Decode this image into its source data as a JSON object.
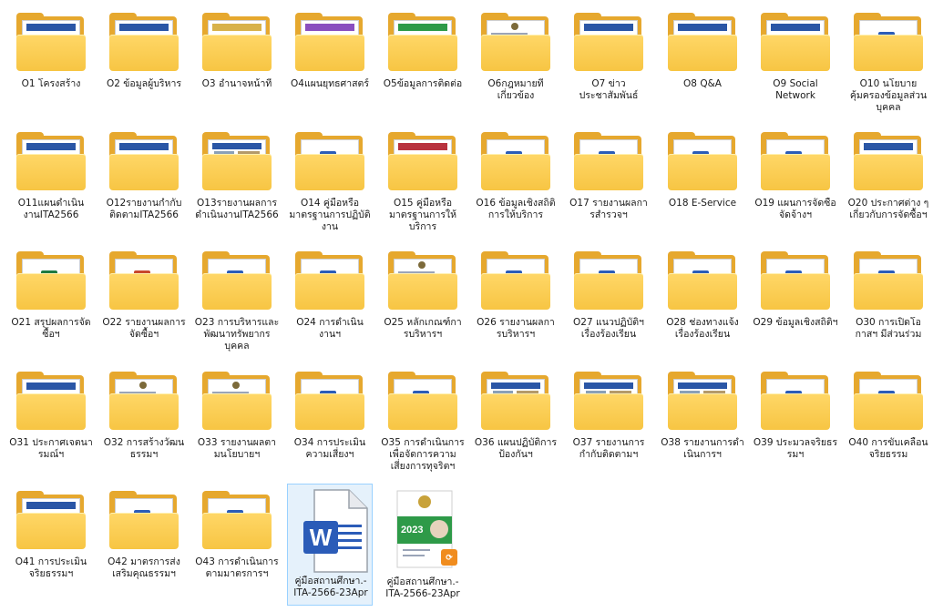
{
  "colors": {
    "folder_front": "#f7c543",
    "folder_back": "#e6a82e",
    "selection_bg": "#e5f1fb",
    "selection_border": "#99d1ff",
    "word_blue": "#2b5cb8",
    "pdf_orange": "#f08c1e"
  },
  "items": [
    {
      "label": "O1 โครงสร้าง",
      "kind": "folder",
      "preview": "doc-banner-blue",
      "icon": "folder-icon"
    },
    {
      "label": "O2 ข้อมูลผู้บริหาร",
      "kind": "folder",
      "preview": "doc-banner-blue",
      "icon": "folder-icon"
    },
    {
      "label": "O3 อำนาจหน้าที่",
      "kind": "folder",
      "preview": "doc-banner-gold",
      "icon": "folder-icon"
    },
    {
      "label": "O4แผนยุทธศาสตร์",
      "kind": "folder",
      "preview": "doc-banner-purple",
      "icon": "folder-icon"
    },
    {
      "label": "O5ข้อมูลการติดต่อ",
      "kind": "folder",
      "preview": "doc-banner-green",
      "icon": "folder-icon"
    },
    {
      "label": "O6กฎหมายที่เกี่ยวข้อง",
      "kind": "folder",
      "preview": "doc-text",
      "icon": "folder-icon"
    },
    {
      "label": "O7 ข่าวประชาสัมพันธ์",
      "kind": "folder",
      "preview": "doc-banner-blue",
      "icon": "folder-icon"
    },
    {
      "label": "O8 Q&A",
      "kind": "folder",
      "preview": "doc-banner-blue",
      "icon": "folder-icon"
    },
    {
      "label": "O9 Social Network",
      "kind": "folder",
      "preview": "doc-banner-blue",
      "icon": "folder-icon"
    },
    {
      "label": "O10 นโยบายคุ้มครองข้อมูลส่วนบุคคล",
      "kind": "folder",
      "preview": "word",
      "icon": "folder-icon"
    },
    {
      "label": "O11แผนดำเนินงานITA2566",
      "kind": "folder",
      "preview": "doc-banner-blue",
      "icon": "folder-icon"
    },
    {
      "label": "O12รายงานกำกับติดตามITA2566",
      "kind": "folder",
      "preview": "doc-banner-blue",
      "icon": "folder-icon"
    },
    {
      "label": "O13รายงานผลการดำเนินงานITA2566",
      "kind": "folder",
      "preview": "doc-photo",
      "icon": "folder-icon"
    },
    {
      "label": "O14 คู่มือหรือมาตรฐานการปฏิบัติงาน",
      "kind": "folder",
      "preview": "word",
      "icon": "folder-icon"
    },
    {
      "label": "O15 คู่มือหรือมาตรฐานการให้บริการ",
      "kind": "folder",
      "preview": "doc-banner-red",
      "icon": "folder-icon"
    },
    {
      "label": "O16 ข้อมูลเชิงสถิติการให้บริการ",
      "kind": "folder",
      "preview": "word",
      "icon": "folder-icon"
    },
    {
      "label": "O17 รายงานผลการสำรวจฯ",
      "kind": "folder",
      "preview": "word",
      "icon": "folder-icon"
    },
    {
      "label": "O18 E-Service",
      "kind": "folder",
      "preview": "word",
      "icon": "folder-icon"
    },
    {
      "label": "O19 แผนการจัดซื้อจัดจ้างฯ",
      "kind": "folder",
      "preview": "word",
      "icon": "folder-icon"
    },
    {
      "label": "O20 ประกาศต่าง ๆ เกี่ยวกับการจัดซื้อฯ",
      "kind": "folder",
      "preview": "doc-banner-blue",
      "icon": "folder-icon"
    },
    {
      "label": "O21 สรุปผลการจัดซื้อฯ",
      "kind": "folder",
      "preview": "excel",
      "icon": "folder-icon"
    },
    {
      "label": "O22 รายงานผลการจัดซื้อฯ",
      "kind": "folder",
      "preview": "powerpoint",
      "icon": "folder-icon"
    },
    {
      "label": "O23 การบริหารและพัฒนาทรัพยากรบุคคล",
      "kind": "folder",
      "preview": "word",
      "icon": "folder-icon"
    },
    {
      "label": "O24 การดำเนินงานฯ",
      "kind": "folder",
      "preview": "word",
      "icon": "folder-icon"
    },
    {
      "label": "O25 หลักเกณฑ์การบริหารฯ",
      "kind": "folder",
      "preview": "doc-text",
      "icon": "folder-icon"
    },
    {
      "label": "O26 รายงานผลการบริหารฯ",
      "kind": "folder",
      "preview": "word",
      "icon": "folder-icon"
    },
    {
      "label": "O27 แนวปฏิบัติฯ เรื่องร้องเรียน",
      "kind": "folder",
      "preview": "word",
      "icon": "folder-icon"
    },
    {
      "label": "O28 ช่องทางแจ้งเรื่องร้องเรียน",
      "kind": "folder",
      "preview": "word",
      "icon": "folder-icon"
    },
    {
      "label": "O29 ข้อมูลเชิงสถิติฯ",
      "kind": "folder",
      "preview": "word",
      "icon": "folder-icon"
    },
    {
      "label": "O30 การเปิดโอกาสฯ มีส่วนร่วม",
      "kind": "folder",
      "preview": "word",
      "icon": "folder-icon"
    },
    {
      "label": "O31 ประกาศเจตนารมณ์ฯ",
      "kind": "folder",
      "preview": "doc-banner-blue",
      "icon": "folder-icon"
    },
    {
      "label": "O32 การสร้างวัฒนธรรมฯ",
      "kind": "folder",
      "preview": "doc-text",
      "icon": "folder-icon"
    },
    {
      "label": "O33 รายงานผลตามนโยบายฯ",
      "kind": "folder",
      "preview": "doc-text",
      "icon": "folder-icon"
    },
    {
      "label": "O34 การประเมินความเสี่ยงฯ",
      "kind": "folder",
      "preview": "word",
      "icon": "folder-icon"
    },
    {
      "label": "O35 การดำเนินการเพื่อจัดการความเสี่ยงการทุจริตฯ",
      "kind": "folder",
      "preview": "word",
      "icon": "folder-icon"
    },
    {
      "label": "O36 แผนปฏิบัติการป้องกันฯ",
      "kind": "folder",
      "preview": "doc-photo",
      "icon": "folder-icon"
    },
    {
      "label": "O37  รายงานการกำกับติดตามฯ",
      "kind": "folder",
      "preview": "doc-photo",
      "icon": "folder-icon"
    },
    {
      "label": "O38 รายงานการดำเนินการฯ",
      "kind": "folder",
      "preview": "doc-photo",
      "icon": "folder-icon"
    },
    {
      "label": "O39 ประมวลจริยธรรมฯ",
      "kind": "folder",
      "preview": "word",
      "icon": "folder-icon"
    },
    {
      "label": "O40 การขับเคลื่อนจริยธรรม",
      "kind": "folder",
      "preview": "word",
      "icon": "folder-icon"
    },
    {
      "label": "O41 การประเมินจริยธรรมฯ",
      "kind": "folder",
      "preview": "doc-banner-blue",
      "icon": "folder-icon"
    },
    {
      "label": "O42 มาตรการส่งเสริมคุณธรรมฯ",
      "kind": "folder",
      "preview": "word",
      "icon": "folder-icon"
    },
    {
      "label": "O43 การดำเนินการตามมาตรการฯ",
      "kind": "folder",
      "preview": "word",
      "icon": "folder-icon"
    },
    {
      "label": "คู่มือสถานศึกษา.-ITA-2566-23Apr",
      "kind": "word-file",
      "preview": "word-doc",
      "icon": "word-document-icon",
      "selected": true
    },
    {
      "label": "คู่มือสถานศึกษา.-ITA-2566-23Apr",
      "kind": "pdf-file",
      "preview": "pdf-cover",
      "icon": "pdf-document-icon",
      "cover_text": "2023"
    }
  ]
}
